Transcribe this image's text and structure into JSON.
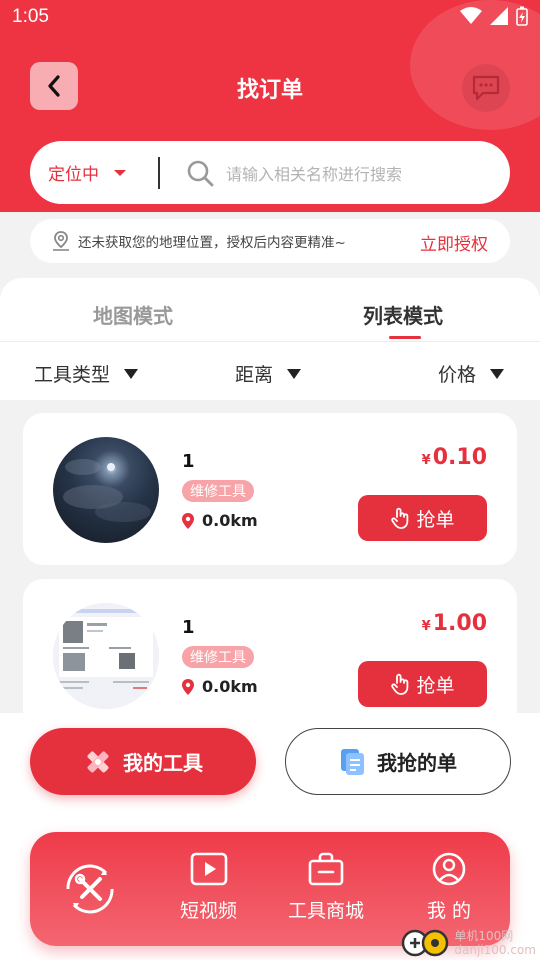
{
  "status_bar": {
    "time": "1:05"
  },
  "header": {
    "title": "找订单"
  },
  "search": {
    "location_label": "定位中",
    "placeholder": "请输入相关名称进行搜索"
  },
  "permission": {
    "text": "还未获取您的地理位置，授权后内容更精准~",
    "action": "立即授权"
  },
  "tabs": [
    {
      "label": "地图模式",
      "active": false
    },
    {
      "label": "列表模式",
      "active": true
    }
  ],
  "filters": [
    {
      "label": "工具类型"
    },
    {
      "label": "距离"
    },
    {
      "label": "价格"
    }
  ],
  "orders": [
    {
      "name": "1",
      "tag": "维修工具",
      "distance": "0.0km",
      "currency": "¥",
      "price": "0.10",
      "action": "抢单"
    },
    {
      "name": "1",
      "tag": "维修工具",
      "distance": "0.0km",
      "currency": "¥",
      "price": "1.00",
      "action": "抢单"
    }
  ],
  "actions": {
    "my_tools": "我的工具",
    "my_grabbed": "我抢的单"
  },
  "nav": [
    {
      "label": "短视频"
    },
    {
      "label": "工具商城"
    },
    {
      "label": "我 的"
    }
  ],
  "watermark": {
    "line1": "单机100网",
    "line2": "danji100.com"
  },
  "colors": {
    "primary": "#ee3343",
    "tag_bg": "#f7a3a7"
  }
}
